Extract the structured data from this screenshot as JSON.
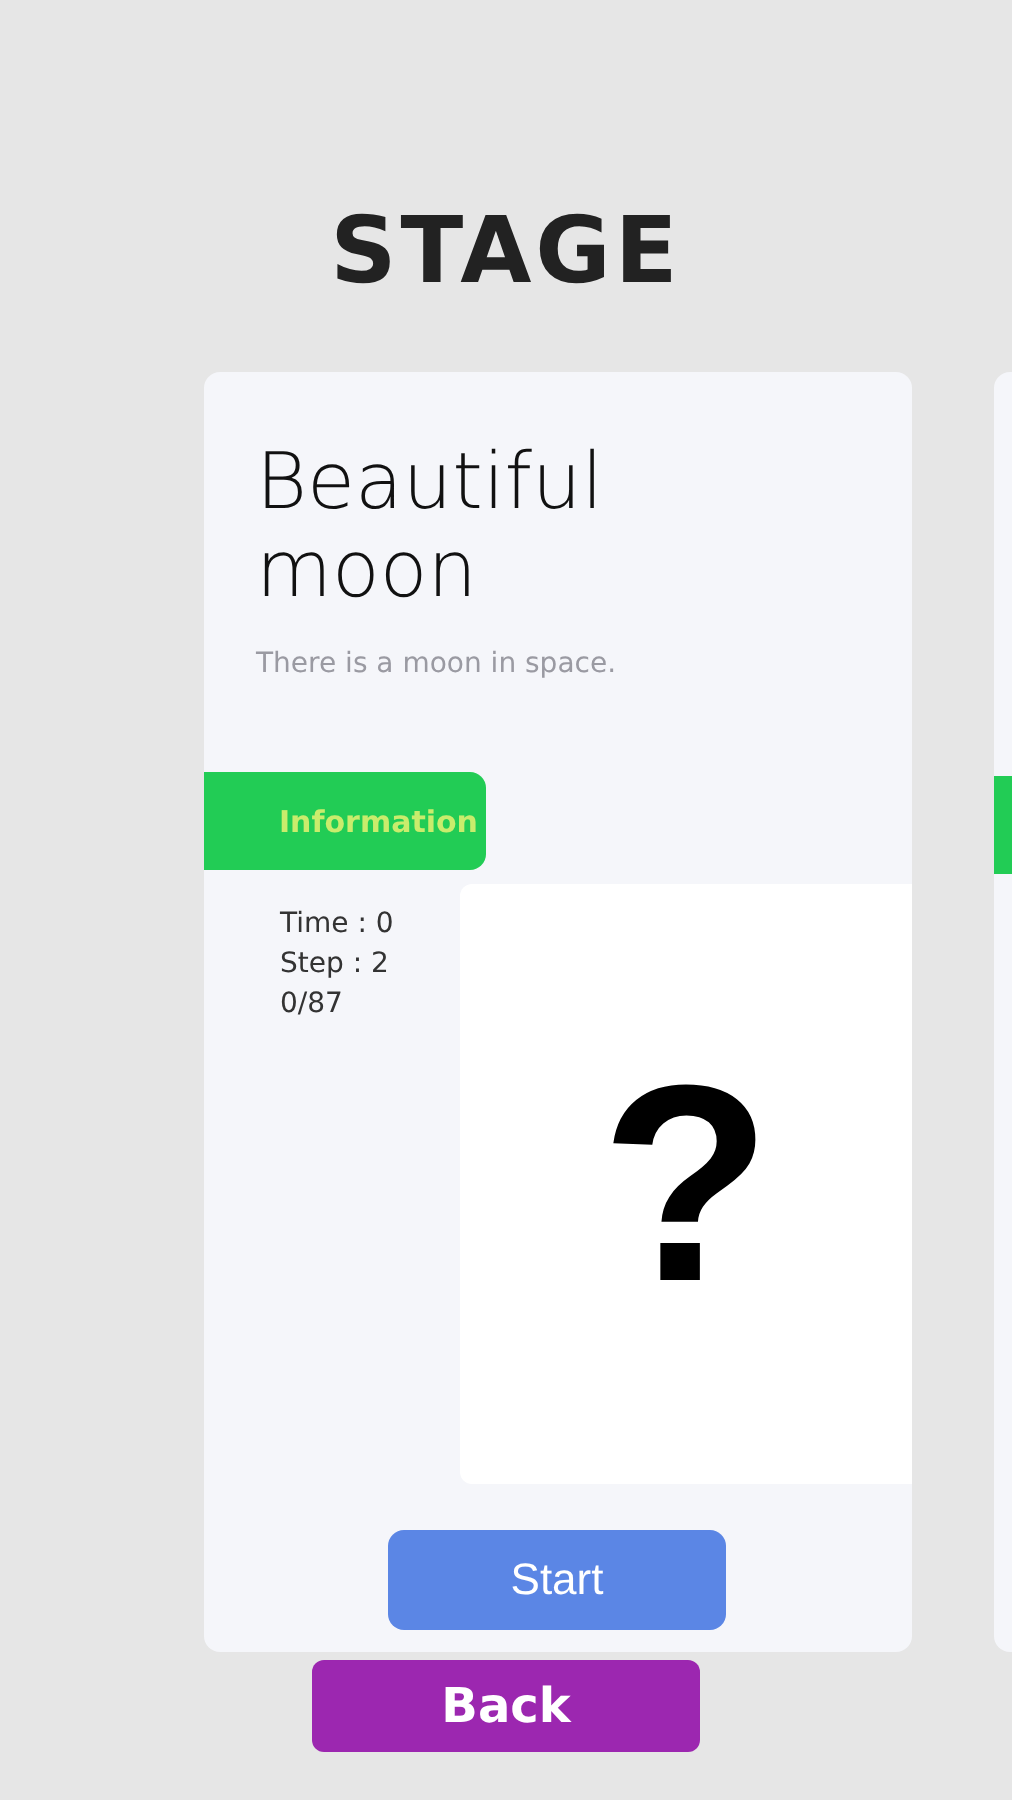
{
  "title": "STAGE",
  "stage": {
    "name": "Beautiful moon",
    "description": "There is a moon in space.",
    "tab": "Information",
    "stats": [
      "Time : 0",
      "Step : 2",
      "0/87"
    ],
    "preview": "?",
    "start_button": "Start"
  },
  "back_button": "Back"
}
